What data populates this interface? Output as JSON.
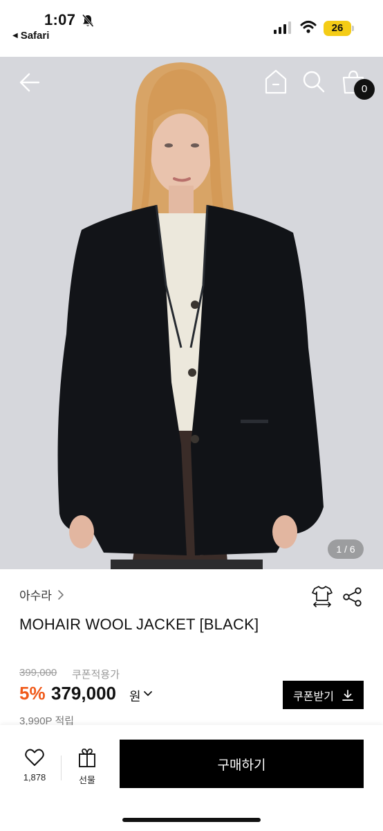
{
  "status_bar": {
    "time": "1:07",
    "back_app": "Safari",
    "battery": "26",
    "icons": [
      "bell-slash-icon",
      "signal-icon",
      "wifi-icon"
    ]
  },
  "nav": {
    "icons": [
      "arrow-left-icon",
      "home-icon",
      "search-icon",
      "shopping-bag-icon"
    ],
    "cart_count": "0"
  },
  "hero": {
    "image_counter": "1 / 6"
  },
  "product": {
    "brand": "아수라",
    "name": "MOHAIR WOOL JACKET [BLACK]",
    "original_price": "399,000",
    "coupon_note": "쿠폰적용가",
    "discount": "5%",
    "price": "379,000",
    "currency": "원",
    "coupon_button": "쿠폰받기",
    "points": "3,990P 적립"
  },
  "bottom_bar": {
    "like_count": "1,878",
    "gift_label": "선물",
    "buy_label": "구매하기"
  },
  "colors": {
    "accent": "#f05a1a",
    "button": "#000000"
  }
}
